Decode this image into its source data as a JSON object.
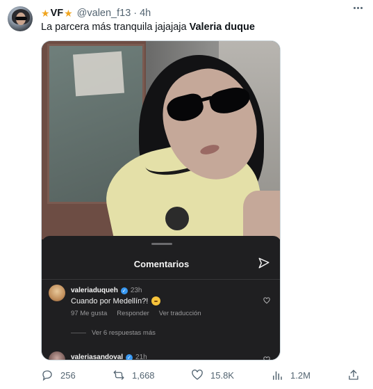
{
  "tweet": {
    "author": {
      "name": "VF",
      "handle": "@valen_f13",
      "separator": "·",
      "time": "4h",
      "star_left": "★",
      "star_right": "★"
    },
    "text_plain": "La parcera más tranquila jajajaja ",
    "text_bold": "Valeria duque"
  },
  "instagram_sheet": {
    "title": "Comentarios",
    "comments": [
      {
        "user": "valeriaduqueh",
        "ago": "23h",
        "text": "Cuando por Medellín?!",
        "likes": "97 Me gusta",
        "reply_label": "Responder",
        "translate_label": "Ver traducción",
        "more_replies": "Ver 6 respuestas más"
      },
      {
        "user": "valeriasandoval",
        "ago": "21h"
      }
    ]
  },
  "metrics": {
    "replies": "256",
    "retweets": "1,668",
    "likes": "15.8K",
    "views": "1.2M"
  },
  "colors": {
    "star": "#f0a520",
    "secondary_text": "#536471",
    "verified": "#3897f0",
    "sheet_bg": "#1f1f21"
  },
  "icons": {
    "more": "more-icon",
    "reply": "reply-icon",
    "retweet": "retweet-icon",
    "like": "heart-icon",
    "views": "views-icon",
    "share": "share-icon",
    "send": "send-icon"
  }
}
